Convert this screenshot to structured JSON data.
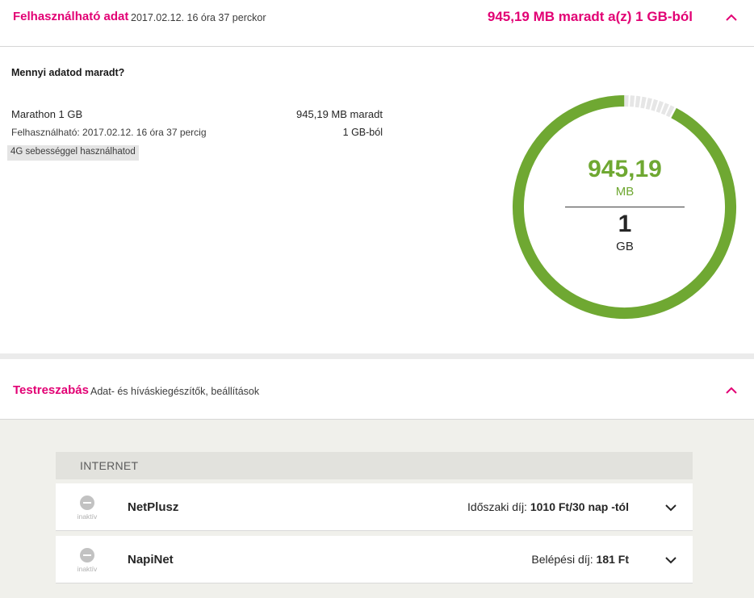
{
  "data_section": {
    "header": {
      "title": "Felhasználható adat",
      "subtitle": "2017.02.12. 16 óra 37 perckor",
      "summary": "945,19 MB maradt a(z) 1 GB-ból",
      "collapse_icon": "chevron-up-icon"
    },
    "question": "Mennyi adatod maradt?",
    "plan": {
      "name": "Marathon 1 GB",
      "remaining_text": "945,19 MB maradt",
      "valid_until": "Felhasználható: 2017.02.12. 16 óra 37 percig",
      "total_text": "1 GB-ból",
      "badge": "4G sebességgel használhatod"
    },
    "gauge": {
      "remaining_value": "945,19",
      "remaining_unit": "MB",
      "total_value": "1",
      "total_unit": "GB",
      "fraction_remaining": 0.923,
      "color_remaining": "#6fa832",
      "color_used": "#e6e6e6"
    }
  },
  "custom_section": {
    "header": {
      "title": "Testreszabás",
      "subtitle": "Adat- és híváskiegészítők, beállítások",
      "collapse_icon": "chevron-up-icon"
    },
    "category": "INTERNET",
    "services": [
      {
        "status": "inaktív",
        "name": "NetPlusz",
        "fee_label": "Időszaki díj:",
        "fee_value": "1010 Ft/30 nap -tól"
      },
      {
        "status": "inaktív",
        "name": "NapiNet",
        "fee_label": "Belépési díj:",
        "fee_value": "181 Ft"
      }
    ]
  },
  "colors": {
    "brand": "#e20074",
    "accent_green": "#6fa832",
    "panel_bg": "#f0f0eb"
  }
}
